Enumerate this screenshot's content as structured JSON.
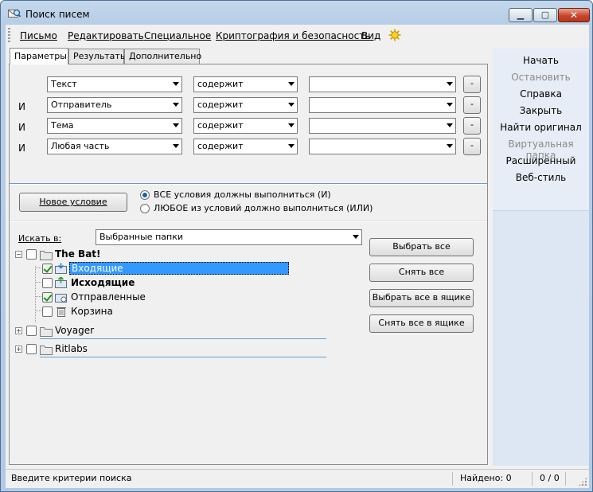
{
  "window": {
    "title": "Поиск писем"
  },
  "menu": [
    "Письмо",
    "Редактировать",
    "Специальное",
    "Криптография и безопасность",
    "Вид"
  ],
  "tabs": [
    "Параметры",
    "Результаты",
    "Дополнительно"
  ],
  "criteria": [
    {
      "prefix": "",
      "field": "Текст",
      "op": "содержит",
      "value": ""
    },
    {
      "prefix": "И",
      "field": "Отправитель",
      "op": "содержит",
      "value": ""
    },
    {
      "prefix": "И",
      "field": "Тема",
      "op": "содержит",
      "value": ""
    },
    {
      "prefix": "И",
      "field": "Любая часть",
      "op": "содержит",
      "value": ""
    }
  ],
  "remove_label": "-",
  "new_condition": "Новое условие",
  "match": {
    "all": "ВСЕ условия должны выполниться (И)",
    "any": "ЛЮБОЕ из условий должно выполниться (ИЛИ)",
    "selected": "all"
  },
  "search_in": {
    "label": "Искать в:",
    "value": "Выбранные папки"
  },
  "tree": {
    "accounts": [
      {
        "name": "The Bat!",
        "expanded": true,
        "checked": false
      },
      {
        "name": "Voyager",
        "expanded": false,
        "checked": false
      },
      {
        "name": "Ritlabs",
        "expanded": false,
        "checked": false
      }
    ],
    "folders": [
      {
        "name": "Входящие",
        "checked": true,
        "selected": true,
        "bold": false
      },
      {
        "name": "Исходящие",
        "checked": false,
        "selected": false,
        "bold": true
      },
      {
        "name": "Отправленные",
        "checked": true,
        "selected": false,
        "bold": false
      },
      {
        "name": "Корзина",
        "checked": false,
        "selected": false,
        "bold": false
      }
    ]
  },
  "select_buttons": [
    "Выбрать все",
    "Снять все",
    "Выбрать все в ящике",
    "Снять все в ящике"
  ],
  "sidebar": [
    {
      "label": "Начать",
      "enabled": true
    },
    {
      "label": "Остановить",
      "enabled": false
    },
    {
      "label": "Справка",
      "enabled": true
    },
    {
      "label": "Закрыть",
      "enabled": true
    },
    {
      "label": "Найти оригинал",
      "enabled": true
    },
    {
      "label": "Виртуальная папка",
      "enabled": false
    },
    {
      "label": "Расширенный",
      "enabled": true
    },
    {
      "label": "Веб-стиль",
      "enabled": true
    }
  ],
  "status": {
    "message": "Введите критерии поиска",
    "found": "Найдено: 0",
    "count": "0 / 0"
  },
  "colors": {
    "accent": "#3399ff",
    "selection": "#3399ff",
    "line": "#6e9bc9"
  }
}
